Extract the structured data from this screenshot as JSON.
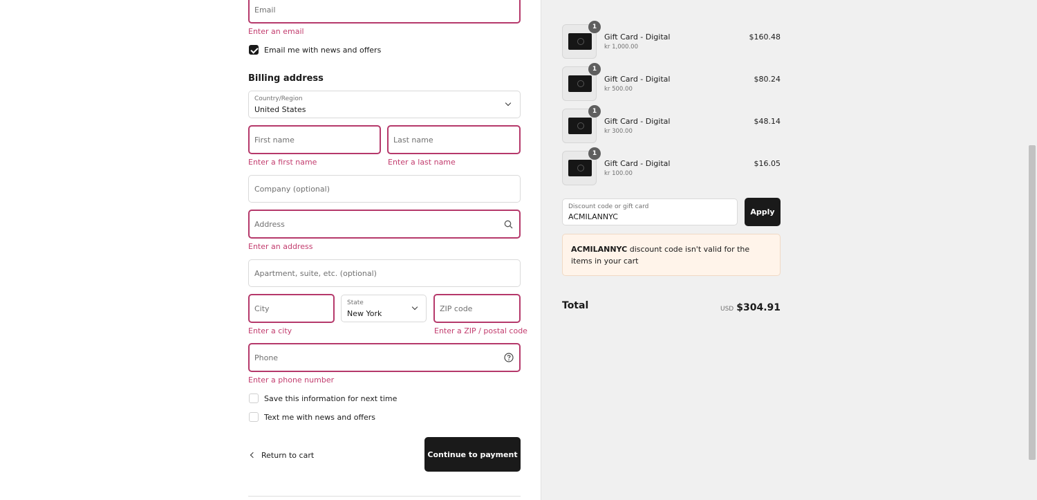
{
  "contact": {
    "email_placeholder": "Email",
    "email_error": "Enter an email",
    "news_checkbox_label": "Email me with news and offers",
    "news_checked": true
  },
  "billing": {
    "heading": "Billing address",
    "country_label": "Country/Region",
    "country_value": "United States",
    "first_name_placeholder": "First name",
    "first_name_error": "Enter a first name",
    "last_name_placeholder": "Last name",
    "last_name_error": "Enter a last name",
    "company_placeholder": "Company (optional)",
    "address_placeholder": "Address",
    "address_error": "Enter an address",
    "apartment_placeholder": "Apartment, suite, etc. (optional)",
    "city_placeholder": "City",
    "city_error": "Enter a city",
    "state_label": "State",
    "state_value": "New York",
    "zip_placeholder": "ZIP code",
    "zip_error": "Enter a ZIP / postal code",
    "phone_placeholder": "Phone",
    "phone_error": "Enter a phone number",
    "save_info_label": "Save this information for next time",
    "text_news_label": "Text me with news and offers"
  },
  "actions": {
    "return_label": "Return to cart",
    "continue_label": "Continue to payment"
  },
  "summary": {
    "items": [
      {
        "qty": "1",
        "name": "Gift Card - Digital",
        "variant": "kr 1,000.00",
        "price": "$160.48"
      },
      {
        "qty": "1",
        "name": "Gift Card - Digital",
        "variant": "kr 500.00",
        "price": "$80.24"
      },
      {
        "qty": "1",
        "name": "Gift Card - Digital",
        "variant": "kr 300.00",
        "price": "$48.14"
      },
      {
        "qty": "1",
        "name": "Gift Card - Digital",
        "variant": "kr 100.00",
        "price": "$16.05"
      }
    ],
    "discount_label": "Discount code or gift card",
    "discount_value": "ACMILANNYC",
    "apply_label": "Apply",
    "discount_error_code": "ACMILANNYC",
    "discount_error_rest": " discount code isn't valid for the items in your cart",
    "total_label": "Total",
    "currency": "USD",
    "total_value": "$304.91"
  },
  "colors": {
    "error": "#c23b6d",
    "error_border": "#b5386a",
    "dark_button": "#1a1a1a",
    "warning_bg": "#fff4ea",
    "summary_bg": "#f0f0f0"
  }
}
